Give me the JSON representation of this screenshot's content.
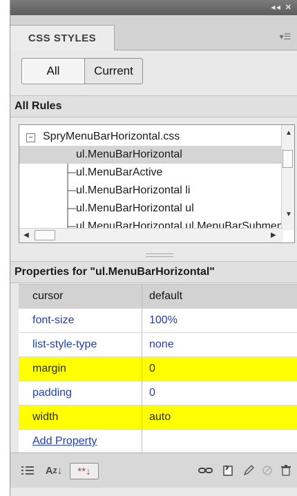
{
  "panel": {
    "tab_label": "CSS STYLES"
  },
  "mode_buttons": {
    "all": "All",
    "current": "Current"
  },
  "all_rules": {
    "heading": "All Rules",
    "file": "SpryMenuBarHorizontal.css",
    "rules": [
      {
        "label": "ul.MenuBarHorizontal",
        "selected": true
      },
      {
        "label": "ul.MenuBarActive",
        "selected": false
      },
      {
        "label": "ul.MenuBarHorizontal li",
        "selected": false
      },
      {
        "label": "ul.MenuBarHorizontal ul",
        "selected": false
      },
      {
        "label": "ul.MenuBarHorizontal ul.MenuBarSubmenuVisible",
        "selected": false
      }
    ]
  },
  "properties": {
    "heading": "Properties for \"ul.MenuBarHorizontal\"",
    "rows": [
      {
        "name": "cursor",
        "value": "default",
        "style": "header"
      },
      {
        "name": "font-size",
        "value": "100%",
        "style": "blue"
      },
      {
        "name": "list-style-type",
        "value": "none",
        "style": "blue"
      },
      {
        "name": "margin",
        "value": "0",
        "style": "highlight"
      },
      {
        "name": "padding",
        "value": "0",
        "style": "blue"
      },
      {
        "name": "width",
        "value": "auto",
        "style": "highlight"
      }
    ],
    "add_property": "Add Property"
  },
  "footer": {
    "icons": [
      "category-view-icon",
      "alphabetical-view-icon",
      "set-properties-view-icon",
      "attach-stylesheet-icon",
      "new-css-rule-icon",
      "edit-rule-icon",
      "disable-property-icon",
      "delete-rule-icon"
    ],
    "icon_glyphs": {
      "az": "A",
      "z": "z"
    }
  },
  "colors": {
    "highlight": "#ffff00",
    "link": "#1f3fb0",
    "selected_row": "#d5d5d5"
  }
}
